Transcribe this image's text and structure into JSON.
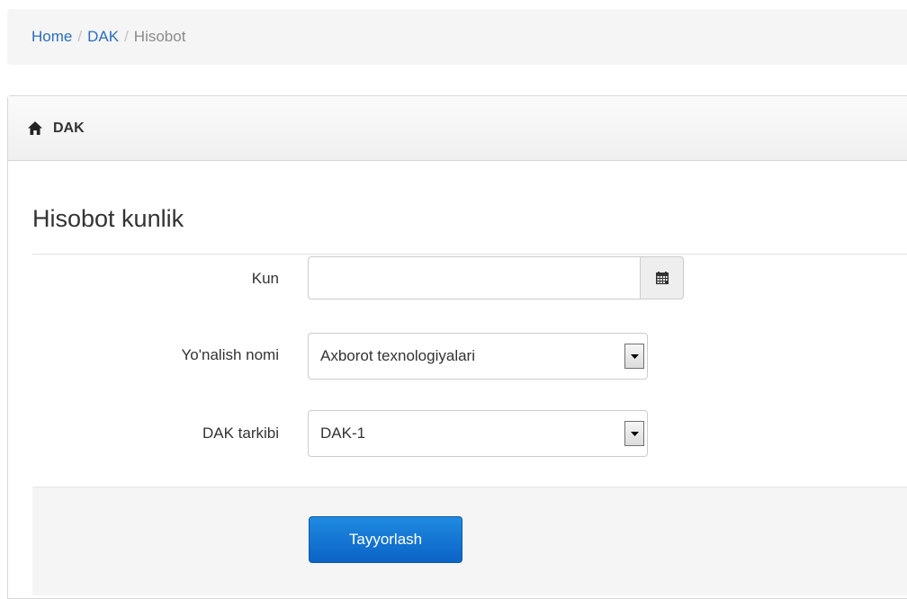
{
  "breadcrumb": {
    "items": [
      {
        "label": "Home"
      },
      {
        "label": "DAK"
      },
      {
        "label": "Hisobot"
      }
    ],
    "separator": "/"
  },
  "panel": {
    "heading": "DAK",
    "heading_icon": "home-icon"
  },
  "form": {
    "title": "Hisobot kunlik",
    "kun": {
      "label": "Kun",
      "value": "",
      "placeholder": "",
      "addon_icon": "calendar-icon"
    },
    "yonalish": {
      "label": "Yo'nalish nomi",
      "selected": "Axborot texnologiyalari"
    },
    "dak": {
      "label": "DAK tarkibi",
      "selected": "DAK-1"
    },
    "submit_label": "Tayyorlash"
  },
  "colors": {
    "link": "#2a6ebb",
    "primary_button": "#1278d4"
  }
}
